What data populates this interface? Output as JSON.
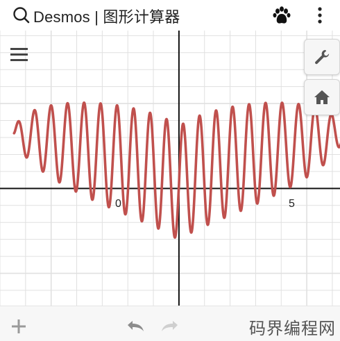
{
  "app": {
    "title": "Desmos | 图形计算器"
  },
  "icons": {
    "search": "search-icon",
    "paw": "paw-icon",
    "more": "more-vertical-icon",
    "menu": "hamburger-menu-icon",
    "wrench": "wrench-icon",
    "home": "home-icon",
    "add": "plus-icon",
    "undo": "undo-icon",
    "redo": "redo-icon"
  },
  "graph": {
    "x_tick_labels": [
      "0",
      "5"
    ],
    "x_range": [
      -7,
      6.3
    ],
    "y_range": [
      -6.9,
      9.3
    ],
    "curve_color": "#c0504d",
    "grid_color": "#e0e0e0",
    "axis_color": "#111111"
  },
  "footer": {
    "watermark": "码界编程网"
  }
}
